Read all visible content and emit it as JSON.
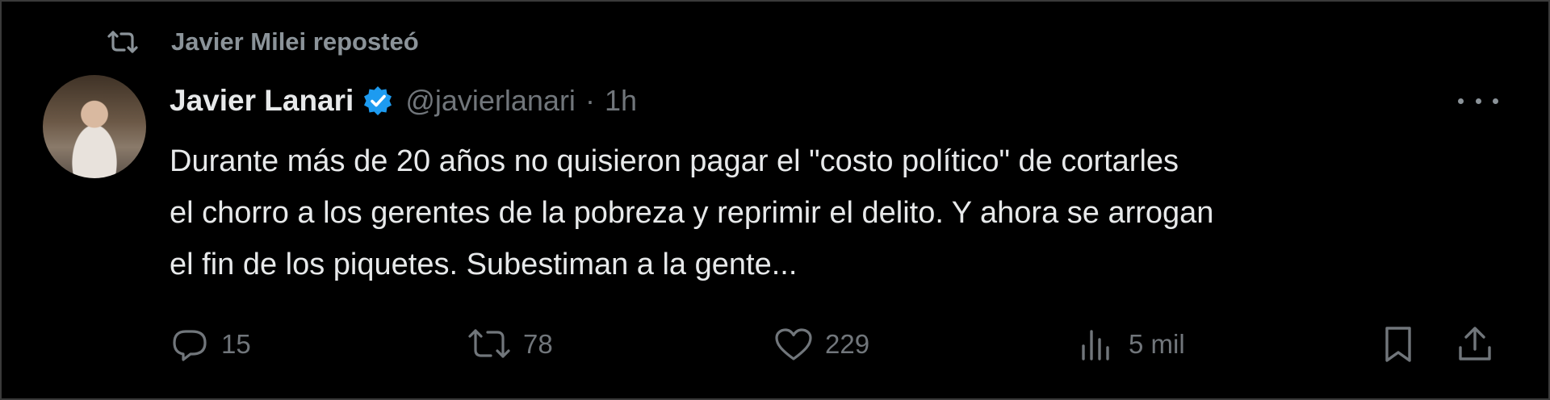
{
  "repost": {
    "label": "Javier Milei reposteó",
    "icon": "repost-icon"
  },
  "tweet": {
    "author_name": "Javier Lanari",
    "verified_icon": "verified-badge-icon",
    "verified_color": "#1d9bf0",
    "handle": "@javierlanari",
    "separator": "·",
    "time": "1h",
    "more_icon": "more-options-icon",
    "text_lines": [
      "Durante más de 20 años no quisieron pagar el \"costo político\" de cortarles",
      "el chorro a los gerentes de la pobreza y reprimir el delito. Y ahora se arrogan",
      "el fin de los piquetes. Subestiman a la gente..."
    ]
  },
  "actions": {
    "reply": {
      "icon": "reply-icon",
      "count": "15"
    },
    "retweet": {
      "icon": "retweet-icon",
      "count": "78"
    },
    "like": {
      "icon": "heart-icon",
      "count": "229"
    },
    "views": {
      "icon": "views-chart-icon",
      "count": "5 mil"
    },
    "bookmark": {
      "icon": "bookmark-icon"
    },
    "share": {
      "icon": "share-icon"
    }
  },
  "colors": {
    "background": "#000000",
    "text": "#e7e9ea",
    "muted": "#71767b"
  }
}
